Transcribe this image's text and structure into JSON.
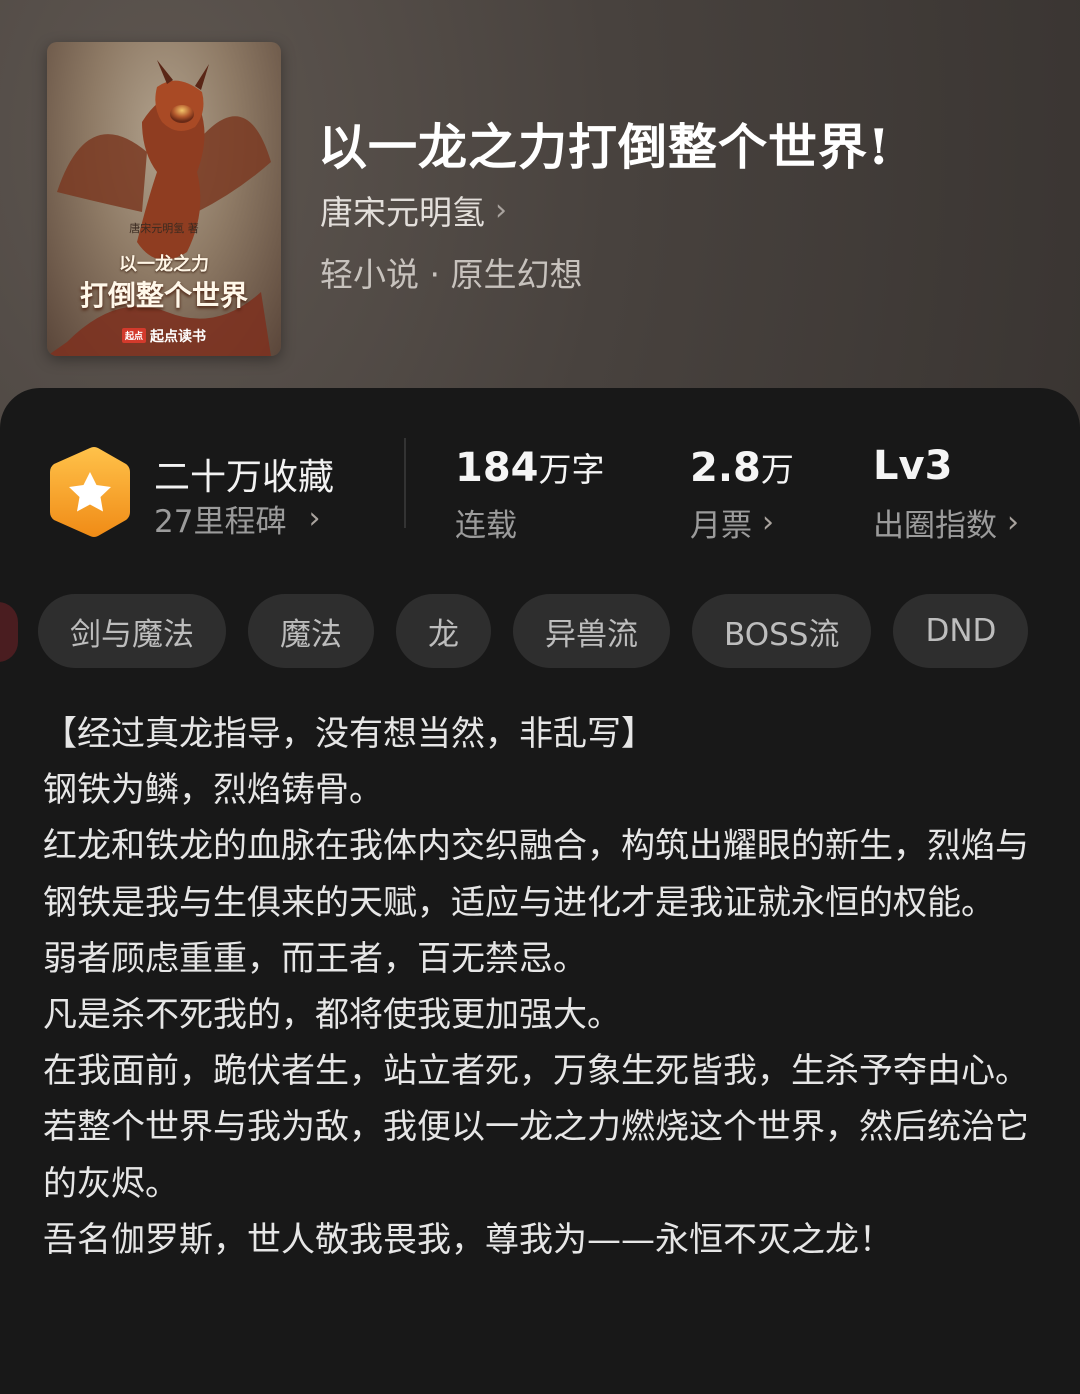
{
  "book": {
    "title": "以一龙之力打倒整个世界!",
    "author": "唐宋元明氢",
    "genre": "轻小说 · 原生幻想",
    "cover": {
      "author_line": "唐宋元明氢 著",
      "subtitle": "以一龙之力",
      "title": "打倒整个世界",
      "brand_mark": "起点",
      "brand": "起点读书"
    }
  },
  "stats": {
    "collection": "二十万收藏",
    "milestones": "27里程碑",
    "word_count": "184",
    "word_unit": "万字",
    "word_label": "连载",
    "monthly_value": "2.8",
    "monthly_unit": "万",
    "monthly_label": "月票",
    "level": "Lv3",
    "level_label": "出圈指数"
  },
  "tags": [
    "剑与魔法",
    "魔法",
    "龙",
    "异兽流",
    "BOSS流",
    "DND"
  ],
  "synopsis": [
    "【经过真龙指导，没有想当然，非乱写】",
    "钢铁为鳞，烈焰铸骨。",
    "红龙和铁龙的血脉在我体内交织融合，构筑出耀眼的新生，烈焰与钢铁是我与生俱来的天赋，适应与进化才是我证就永恒的权能。",
    "弱者顾虑重重，而王者，百无禁忌。",
    "凡是杀不死我的，都将使我更加强大。",
    "在我面前，跪伏者生，站立者死，万象生死皆我，生杀予夺由心。",
    "若整个世界与我为敌，我便以一龙之力燃烧这个世界，然后统治它的灰烬。",
    "吾名伽罗斯，世人敬我畏我，尊我为——永恒不灭之龙！"
  ],
  "colors": {
    "panel": "#181818",
    "tag_bg": "#2e2e2e",
    "badge": "#f5a623"
  },
  "icons": {
    "chevron": "chevron-right-icon",
    "badge": "star-hexagon-icon"
  }
}
